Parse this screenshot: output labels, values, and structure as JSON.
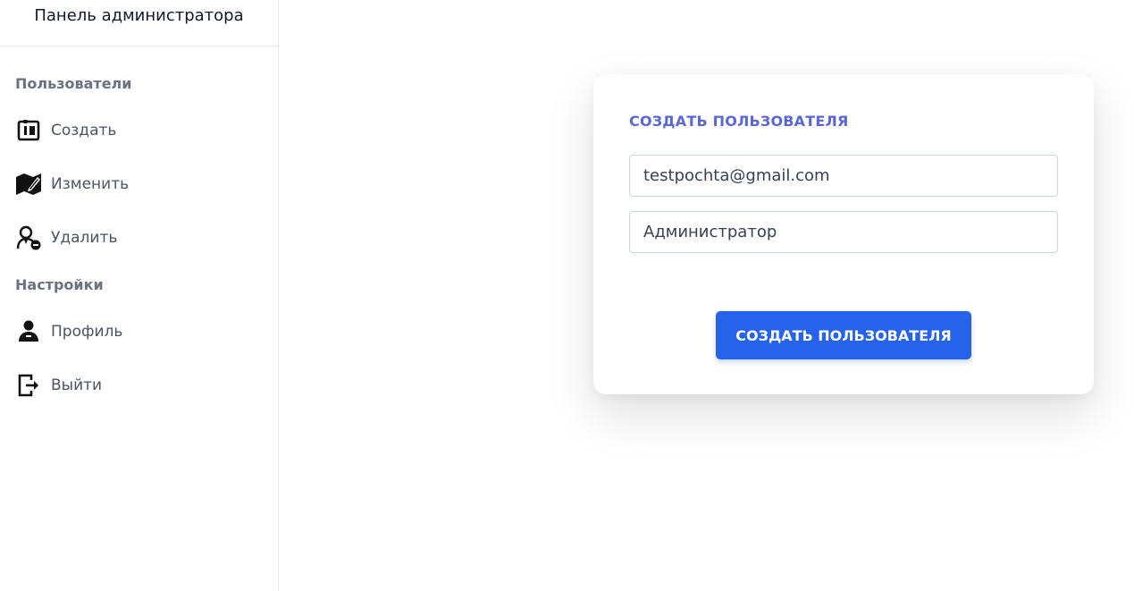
{
  "sidebar": {
    "title": "Панель администратора",
    "sections": [
      {
        "title": "Пользователи",
        "items": [
          {
            "label": "Создать",
            "icon": "create-user-icon"
          },
          {
            "label": "Изменить",
            "icon": "edit-icon"
          },
          {
            "label": "Удалить",
            "icon": "delete-user-icon"
          }
        ]
      },
      {
        "title": "Настройки",
        "items": [
          {
            "label": "Профиль",
            "icon": "profile-icon"
          },
          {
            "label": "Выйти",
            "icon": "logout-icon"
          }
        ]
      }
    ]
  },
  "form": {
    "title": "СОЗДАТЬ ПОЛЬЗОВАТЕЛЯ",
    "email_value": "testpochta@gmail.com",
    "role_value": "Администратор",
    "submit_label": "СОЗДАТЬ ПОЛЬЗОВАТЕЛЯ"
  },
  "colors": {
    "accent": "#2563eb",
    "title": "#5a67d8",
    "section_title": "#6b7280"
  }
}
